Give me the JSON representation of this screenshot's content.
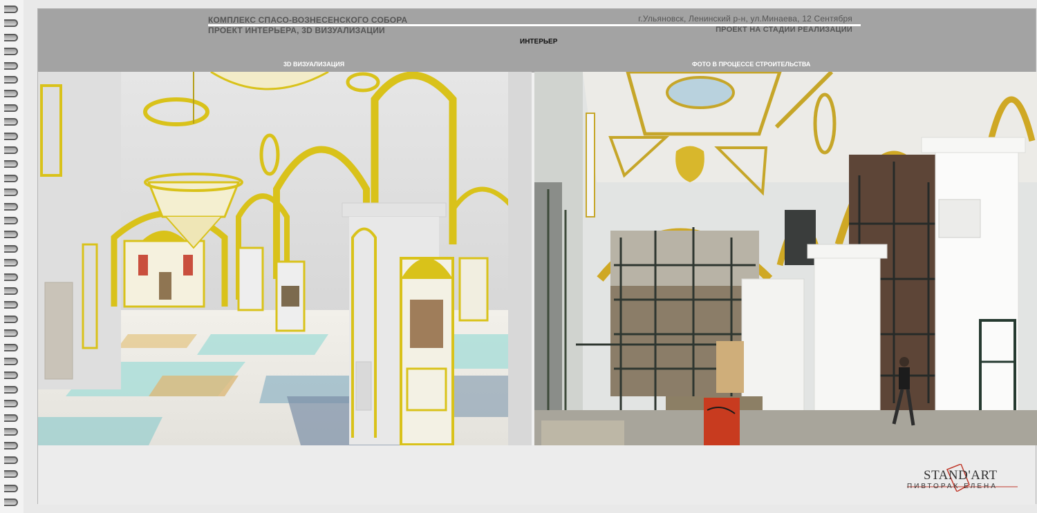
{
  "header": {
    "title_left_1": "КОМПЛЕКС СПАСО-ВОЗНЕСЕНСКОГО СОБОРА",
    "title_left_2": "ПРОЕКТ ИНТЕРЬЕРА, 3D ВИЗУАЛИЗАЦИИ",
    "title_right_1": "г.Ульяновск, Ленинский р-н, ул.Минаева, 12 Сентября",
    "title_right_2": "ПРОЕКТ НА СТАДИИ РЕАЛИЗАЦИИ",
    "section": "ИНТЕРЬЕР"
  },
  "panels": {
    "left_label": "3D ВИЗУАЛИЗАЦИЯ",
    "right_label": "ФОТО В ПРОЦЕССЕ СТРОИТЕЛЬСТВА"
  },
  "logo": {
    "name": "STAND'ART",
    "author": "ПИВТОРАК ЕЛЕНА",
    "accent_color": "#c0392b"
  },
  "colors": {
    "header_bg": "#a3a3a3",
    "gold": "#d9c21a",
    "floor_turquoise": "#9fd8d4"
  }
}
